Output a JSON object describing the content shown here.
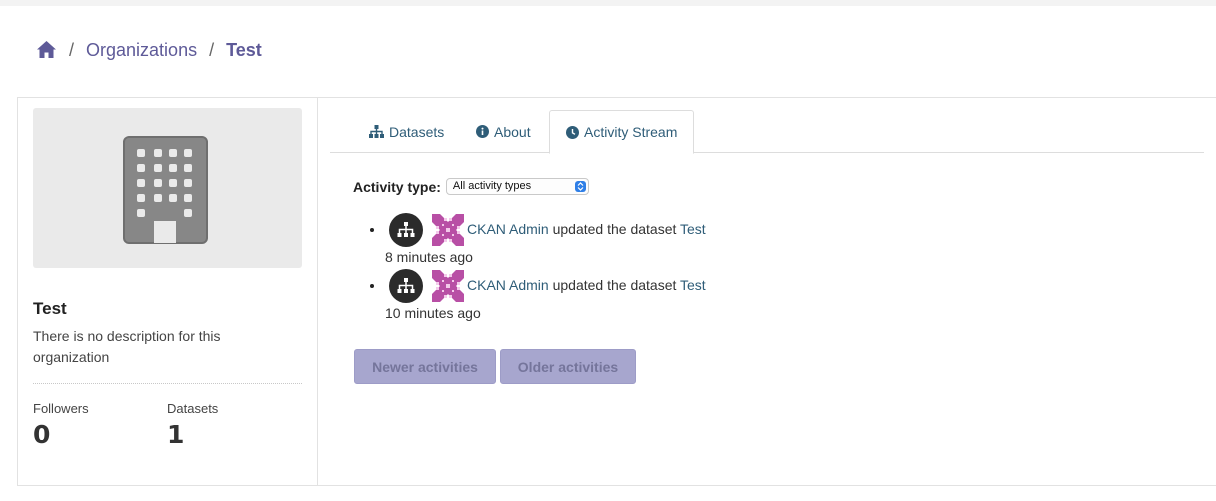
{
  "breadcrumb": {
    "home_icon": "home-icon",
    "organizations": "Organizations",
    "current": "Test",
    "separator": "/"
  },
  "colors": {
    "brand": "#5e5a98",
    "link": "#2f5d78",
    "pager_bg": "#a7a6ce"
  },
  "sidebar": {
    "image_icon": "building-icon",
    "org_name": "Test",
    "description": "There is no description for this organization",
    "stats": [
      {
        "label": "Followers",
        "value": "0"
      },
      {
        "label": "Datasets",
        "value": "1"
      }
    ]
  },
  "tabs": [
    {
      "label": "Datasets",
      "icon": "sitemap-icon",
      "active": false
    },
    {
      "label": "About",
      "icon": "info-circle-icon",
      "active": false
    },
    {
      "label": "Activity Stream",
      "icon": "clock-icon",
      "active": true
    }
  ],
  "activity": {
    "filter_label": "Activity type:",
    "filter_value": "All activity types",
    "items": [
      {
        "actor": "CKAN Admin",
        "action": "updated the dataset",
        "target": "Test",
        "time": "8 minutes ago"
      },
      {
        "actor": "CKAN Admin",
        "action": "updated the dataset",
        "target": "Test",
        "time": "10 minutes ago"
      }
    ],
    "newer_label": "Newer activities",
    "older_label": "Older activities"
  }
}
